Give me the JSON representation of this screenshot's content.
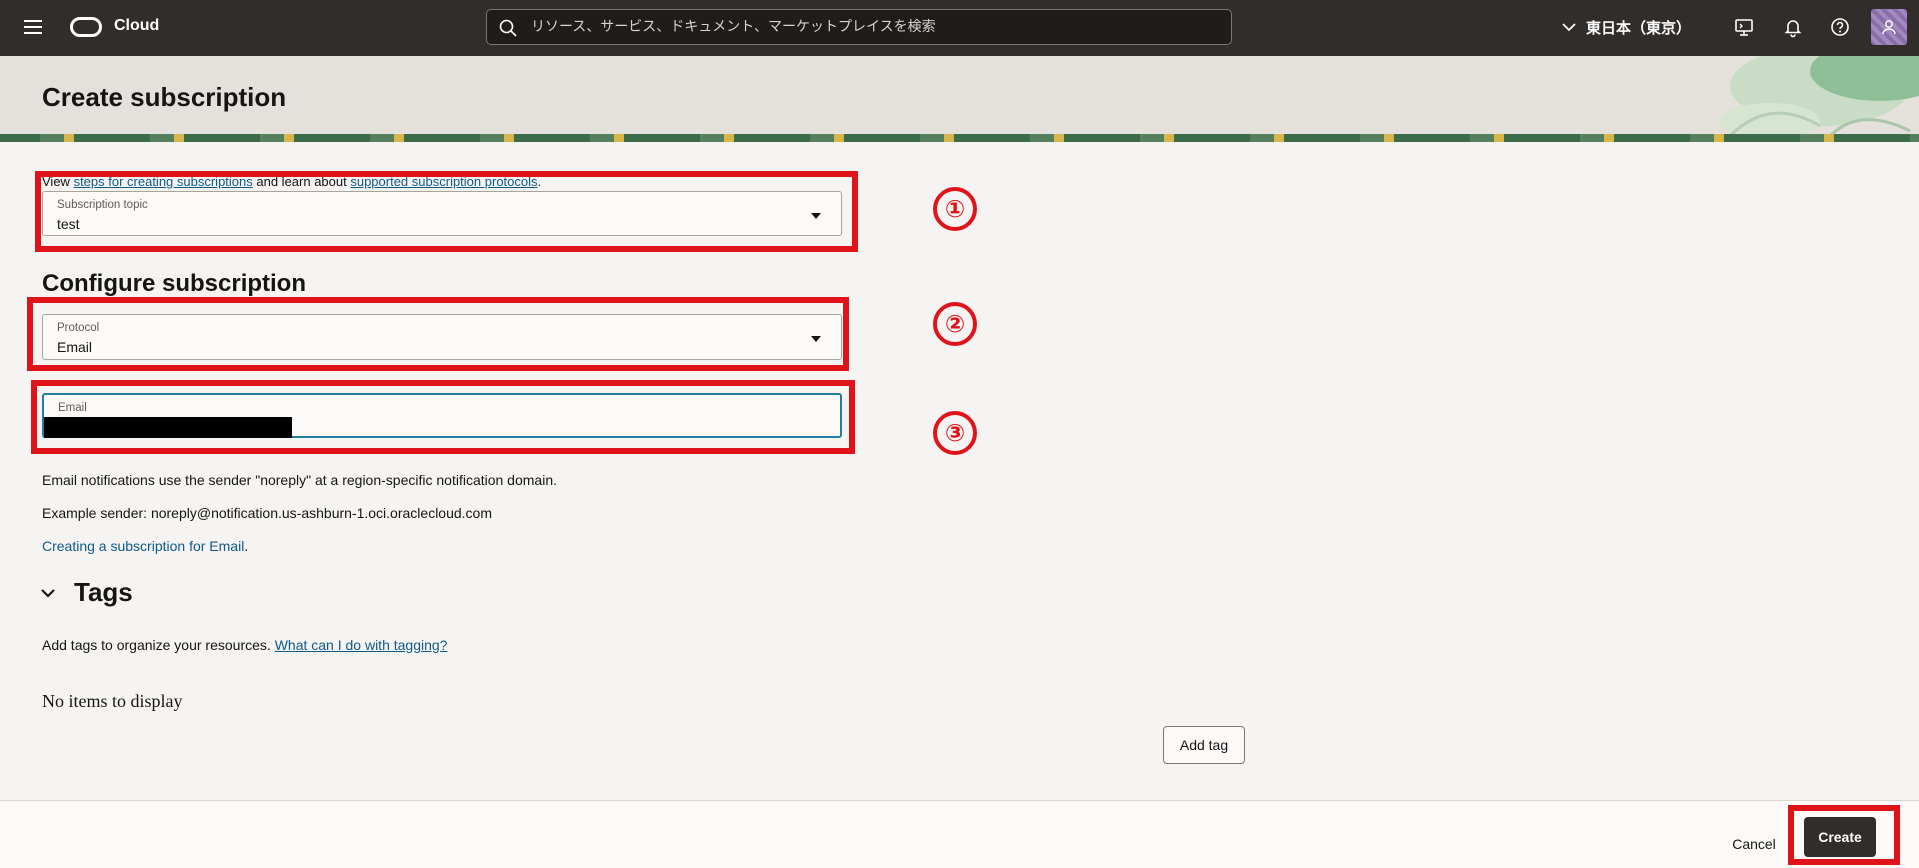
{
  "topbar": {
    "brand": "Cloud",
    "search_placeholder": "リソース、サービス、ドキュメント、マーケットプレイスを検索",
    "region": "東日本（東京）"
  },
  "header": {
    "title": "Create subscription"
  },
  "intro": {
    "prefix": "View ",
    "link1": "steps for creating subscriptions",
    "middle": " and learn about ",
    "link2": "supported subscription protocols",
    "suffix": "."
  },
  "subscription_topic": {
    "label": "Subscription topic",
    "value": "test"
  },
  "configure": {
    "title": "Configure subscription"
  },
  "protocol": {
    "label": "Protocol",
    "value": "Email"
  },
  "email": {
    "label": "Email",
    "value": ""
  },
  "notes": {
    "line1": "Email notifications use the sender \"noreply\" at a region-specific notification domain.",
    "line2": "Example sender: noreply@notification.us-ashburn-1.oci.oraclecloud.com",
    "link": "Creating a subscription for Email",
    "link_suffix": "."
  },
  "tags": {
    "title": "Tags",
    "description": "Add tags to organize your resources. ",
    "help_link": "What can I do with tagging?",
    "empty": "No items to display",
    "add_label": "Add tag"
  },
  "footer": {
    "cancel_label": "Cancel",
    "create_label": "Create"
  },
  "annotations": {
    "marker1": "①",
    "marker2": "②",
    "marker3": "③"
  },
  "colors": {
    "highlight": "#e0131b",
    "topbar": "#312d2a",
    "link": "#0f5a8a",
    "focus": "#227e9e"
  }
}
